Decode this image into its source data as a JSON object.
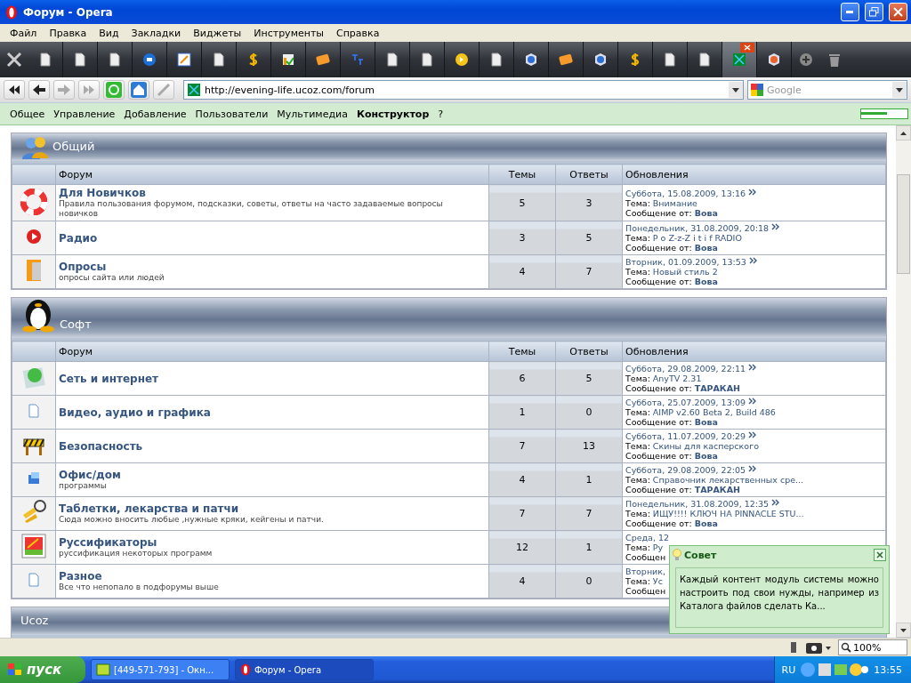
{
  "window": {
    "title": "Форум - Opera"
  },
  "menu": [
    "Файл",
    "Правка",
    "Вид",
    "Закладки",
    "Виджеты",
    "Инструменты",
    "Справка"
  ],
  "tabs": [
    {
      "kind": "page",
      "selected": false
    },
    {
      "kind": "page",
      "selected": false
    },
    {
      "kind": "page",
      "selected": false
    },
    {
      "kind": "bluecircle",
      "selected": false
    },
    {
      "kind": "edit",
      "selected": false
    },
    {
      "kind": "page",
      "selected": false
    },
    {
      "kind": "dollar",
      "selected": false
    },
    {
      "kind": "chart",
      "selected": false
    },
    {
      "kind": "card",
      "selected": false
    },
    {
      "kind": "translate",
      "selected": false
    },
    {
      "kind": "page",
      "selected": false
    },
    {
      "kind": "page",
      "selected": false
    },
    {
      "kind": "coin",
      "selected": false
    },
    {
      "kind": "page",
      "selected": false
    },
    {
      "kind": "ucircle",
      "selected": false
    },
    {
      "kind": "card",
      "selected": false
    },
    {
      "kind": "ucircle",
      "selected": false
    },
    {
      "kind": "dollar",
      "selected": false
    },
    {
      "kind": "page",
      "selected": false
    },
    {
      "kind": "page",
      "selected": false
    },
    {
      "kind": "site",
      "selected": true
    },
    {
      "kind": "ocircle",
      "selected": false
    }
  ],
  "address": {
    "value": "http://evening-life.ucoz.com/forum"
  },
  "search": {
    "placeholder": "Google"
  },
  "admin_bar": [
    {
      "label": "Общее",
      "selected": false
    },
    {
      "label": "Управление",
      "selected": false
    },
    {
      "label": "Добавление",
      "selected": false
    },
    {
      "label": "Пользователи",
      "selected": false
    },
    {
      "label": "Мультимедиа",
      "selected": false
    },
    {
      "label": "Конструктор",
      "selected": true
    },
    {
      "label": "?",
      "selected": false
    }
  ],
  "panel_slider": {
    "level": 0.55
  },
  "sections": [
    {
      "title": "Общий",
      "columns": [
        "Форум",
        "Темы",
        "Ответы",
        "Обновления"
      ],
      "rows": [
        {
          "name": "Для Новичков",
          "description": "Правила пользования форумом, подсказки, советы, ответы на часто задаваемые вопросы новичков",
          "topics": "5",
          "replies": "3",
          "update": {
            "date": "Суббота, 15.08.2009, 13:16",
            "topic_label": "Тема:",
            "topic": "Внимание",
            "by_label": "Сообщение от:",
            "author": "Вова"
          }
        },
        {
          "name": "Радио",
          "topics": "3",
          "replies": "5",
          "update": {
            "date": "Понедельник, 31.08.2009, 20:18",
            "topic_label": "Тема:",
            "topic": "P o Z-z-Z i t i f RADIO",
            "by_label": "Сообщение от:",
            "author": "Вова"
          }
        },
        {
          "name": "Опросы",
          "description": "опросы сайта или людей",
          "topics": "4",
          "replies": "7",
          "update": {
            "date": "Вторник, 01.09.2009, 13:53",
            "topic_label": "Тема:",
            "topic": "Новый стиль 2",
            "by_label": "Сообщение от:",
            "author": "Вова"
          }
        }
      ]
    },
    {
      "title": "Софт",
      "columns": [
        "Форум",
        "Темы",
        "Ответы",
        "Обновления"
      ],
      "rows": [
        {
          "name": "Сеть и интернет",
          "topics": "6",
          "replies": "5",
          "update": {
            "date": "Суббота, 29.08.2009, 22:11",
            "topic_label": "Тема:",
            "topic": "AnyTV 2.31",
            "by_label": "Сообщение от:",
            "author": "ТАРАКАН"
          }
        },
        {
          "name": "Видео, аудио и графика",
          "topics": "1",
          "replies": "0",
          "update": {
            "date": "Суббота, 25.07.2009, 13:09",
            "topic_label": "Тема:",
            "topic": "AIMP v2.60 Beta 2, Build 486",
            "by_label": "Сообщение от:",
            "author": "Вова"
          }
        },
        {
          "name": "Безопасность",
          "topics": "7",
          "replies": "13",
          "update": {
            "date": "Суббота, 11.07.2009, 20:29",
            "topic_label": "Тема:",
            "topic": "Скины для касперского",
            "by_label": "Сообщение от:",
            "author": "Вова"
          }
        },
        {
          "name": "Офис/дом",
          "description": "программы",
          "topics": "4",
          "replies": "1",
          "update": {
            "date": "Суббота, 29.08.2009, 22:05",
            "topic_label": "Тема:",
            "topic": "Справочник лекарственных сре...",
            "by_label": "Сообщение от:",
            "author": "ТАРАКАН"
          }
        },
        {
          "name": "Таблетки, лекарства и патчи",
          "description": "Сюда можно вносить любые ,нужные кряки, кейгены и патчи.",
          "topics": "7",
          "replies": "7",
          "update": {
            "date": "Понедельник, 31.08.2009, 12:35",
            "topic_label": "Тема:",
            "topic": "ИЩУ!!!! КЛЮЧ НА PINNACLE STU...",
            "by_label": "Сообщение от:",
            "author": "Вова"
          }
        },
        {
          "name": "Руссификаторы",
          "description": "руссификация некоторых программ",
          "topics": "12",
          "replies": "1",
          "update": {
            "date": "Среда, 12",
            "topic_label": "Тема:",
            "topic": "Ру",
            "by_label": "Сообщен"
          }
        },
        {
          "name": "Разное",
          "description": "Все что непопало в подфорумы выше",
          "topics": "4",
          "replies": "0",
          "update": {
            "date": "Вторник,",
            "topic_label": "Тема:",
            "topic": "Ус",
            "by_label": "Сообщен"
          }
        }
      ]
    },
    {
      "title": "Ucoz"
    }
  ],
  "tip": {
    "title": "Совет",
    "text": "Каждый контент модуль системы можно настроить под свои нужды, например из Каталога файлов сделать Ка..."
  },
  "status_bar": {
    "zoom": "100%"
  },
  "taskbar": {
    "start": "пуск",
    "tasks": [
      {
        "label": "[449-571-793] - Окн...",
        "selected": false
      },
      {
        "label": "Форум - Opera",
        "selected": true
      }
    ],
    "language": "RU",
    "time": "13:55"
  }
}
